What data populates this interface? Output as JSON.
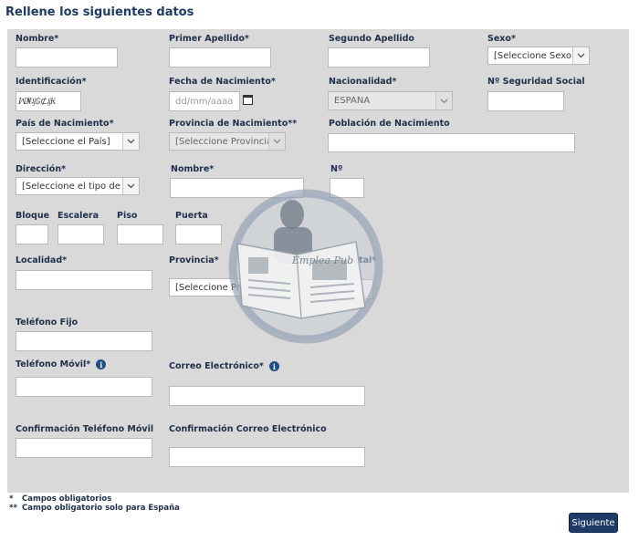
{
  "form_title": "Rellene los siguientes datos",
  "labels": {
    "nombre": "Nombre*",
    "primer_apellido": "Primer Apellido*",
    "segundo_apellido": "Segundo Apellido",
    "sexo": "Sexo*",
    "identificacion": "Identificación*",
    "fecha_nacimiento": "Fecha de Nacimiento*",
    "nacionalidad": "Nacionalidad*",
    "seguridad_social": "Nº Seguridad Social",
    "pais_nacimiento": "País de Nacimiento*",
    "provincia_nacimiento": "Provincia de Nacimiento**",
    "poblacion_nacimiento": "Población de Nacimiento",
    "direccion": "Dirección*",
    "nombre_via": "Nombre*",
    "numero": "Nº",
    "bloque": "Bloque",
    "escalera": "Escalera",
    "piso": "Piso",
    "puerta": "Puerta",
    "localidad": "Localidad*",
    "provincia": "Provincia*",
    "codigo_postal": "C. Postal*",
    "telefono_fijo": "Teléfono Fijo",
    "telefono_movil": "Teléfono Móvil*",
    "correo": "Correo Electrónico*",
    "conf_telefono": "Confirmación Teléfono Móvil",
    "conf_correo": "Confirmación Correo Electrónico"
  },
  "selects": {
    "sexo": "[Seleccione Sexo]",
    "nacionalidad": "ESPAÑA",
    "pais": "[Seleccione el País]",
    "provincia_nacimiento": "[Seleccione Provincia]",
    "tipo_via": "[Seleccione el tipo de vía]",
    "provincia": "[Seleccione Provincia]"
  },
  "placeholders": {
    "fecha": "dd/mm/aaaa"
  },
  "identificacion_value": "ꟽ₦₰₲⊄₰₭",
  "info_glyph": "i",
  "notes": {
    "obligatorios_mark": "*",
    "obligatorios": "Campos obligatorios",
    "espana_mark": "**",
    "espana": "Campo obligatorio solo para España"
  },
  "next_button": "Siguiente",
  "watermark_text": "Emplea Pub",
  "colors": {
    "panel": "#d9d9d9",
    "title": "#1e3a66",
    "button": "#1e3a66",
    "info_icon": "#1f4f8a"
  }
}
